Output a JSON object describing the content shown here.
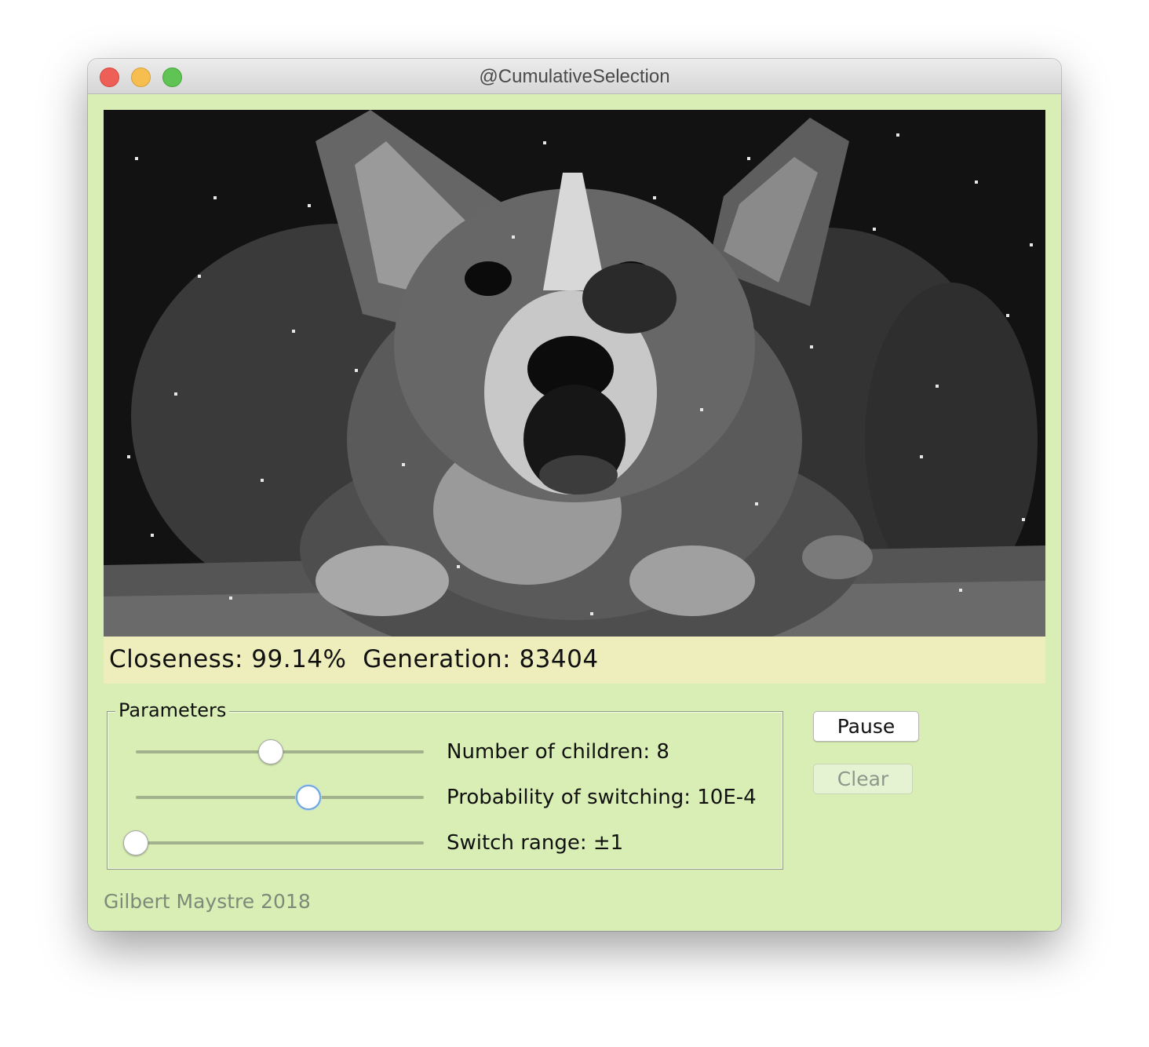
{
  "window": {
    "title": "@CumulativeSelection"
  },
  "canvas": {
    "image_subject": "pixelated grayscale corgi photo"
  },
  "status": {
    "closeness_label": "Closeness:",
    "closeness_value": "99.14%",
    "generation_label": "Generation:",
    "generation_value": "83404"
  },
  "parameters": {
    "legend": "Parameters",
    "sliders": [
      {
        "label": "Number of children: 8",
        "level": 0.47
      },
      {
        "label": "Probability of switching: 10E-4",
        "level": 0.6
      },
      {
        "label": "Switch range: ±1",
        "level": 0.0
      }
    ]
  },
  "buttons": {
    "pause": "Pause",
    "clear": "Clear"
  },
  "footer": {
    "credit": "Gilbert Maystre 2018"
  },
  "colors": {
    "window_bg": "#d9eeb5",
    "status_bg": "#eeeebc",
    "slider_focus": "#6fa8d9"
  },
  "icons": [
    "close-window-icon",
    "minimize-window-icon",
    "zoom-window-icon"
  ]
}
